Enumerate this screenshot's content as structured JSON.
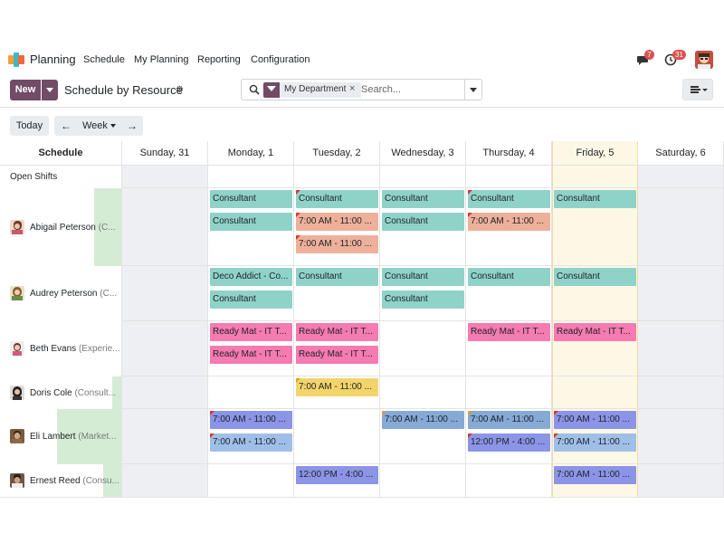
{
  "nav": {
    "app_name": "Planning",
    "menu": [
      "Schedule",
      "My Planning",
      "Reporting",
      "Configuration"
    ],
    "messages_badge": "7",
    "activities_badge": "31"
  },
  "control": {
    "new_label": "New",
    "view_title": "Schedule by Resource",
    "search_facet": "My Department",
    "search_placeholder": "Search..."
  },
  "toolbar": {
    "today_label": "Today",
    "scale_label": "Week"
  },
  "grid": {
    "schedule_header": "Schedule",
    "days": [
      "Sunday, 31",
      "Monday, 1",
      "Tuesday, 2",
      "Wednesday, 3",
      "Thursday, 4",
      "Friday, 5",
      "Saturday, 6"
    ],
    "open_shifts_label": "Open Shifts",
    "rows": [
      {
        "name": "Abigail Peterson",
        "role": "(C..."
      },
      {
        "name": "Audrey Peterson",
        "role": "(C..."
      },
      {
        "name": "Beth Evans",
        "role": "(Experie..."
      },
      {
        "name": "Doris Cole",
        "role": "(Consult..."
      },
      {
        "name": "Eli Lambert",
        "role": "(Market..."
      },
      {
        "name": "Ernest Reed",
        "role": "(Consu..."
      }
    ],
    "shifts": {
      "consultant": "Consultant",
      "morning": "7:00 AM - 11:00 ...",
      "deco": "Deco Addict - Co...",
      "ready_mat": "Ready Mat - IT T...",
      "afternoon": "12:00 PM - 4:00 ..."
    }
  },
  "colors": {
    "brand": "#714b67",
    "consultant": "#8fd3c8",
    "salmon": "#eeb09a",
    "pink": "#f57bb0",
    "yellow": "#f2d46a",
    "indigo": "#8b94e6",
    "lightblue": "#9fbfe8",
    "steelblue": "#86a9d6",
    "today_bg": "#fdf8e6",
    "weekend_bg": "#eeeff2"
  }
}
